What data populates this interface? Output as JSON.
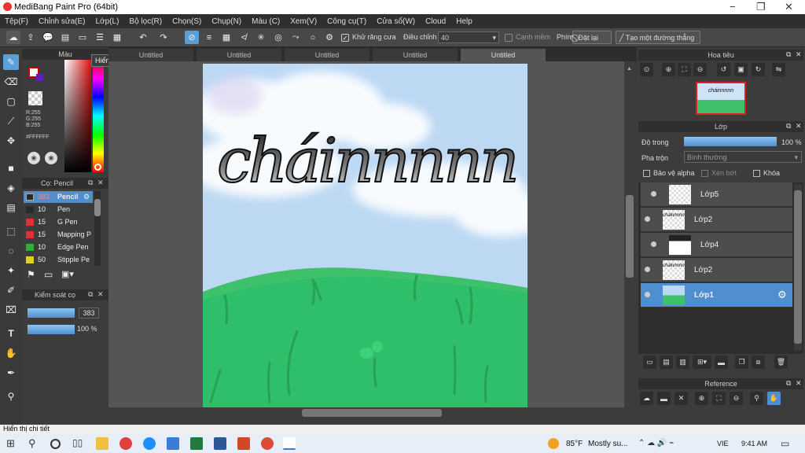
{
  "window": {
    "title": "MediBang Paint Pro (64bit)",
    "minimize": "−",
    "maximize": "❐",
    "close": "✕"
  },
  "menu": [
    "Tệp(F)",
    "Chỉnh sửa(E)",
    "Lớp(L)",
    "Bộ lọc(R)",
    "Chọn(S)",
    "Chụp(N)",
    "Màu (C)",
    "Xem(V)",
    "Công cụ(T)",
    "Cửa sổ(W)",
    "Cloud",
    "Help"
  ],
  "toolbar": {
    "antialias_label": "Khử răng cưa",
    "adjust_label": "Điều chỉnh",
    "adjust_value": "40",
    "edge_label": "Cạnh mềm",
    "key_label": "Phím",
    "reset_label": "Đặt lại",
    "straight_label": "Tạo một đường thẳng"
  },
  "tooltip": "Hiển thị chi tiết",
  "color_panel": {
    "title": "Màu",
    "r": "R:255",
    "g": "G:255",
    "b": "B:255",
    "hex": "#FFFFFF"
  },
  "brush_panel": {
    "title": "Cọ: Pencil",
    "items": [
      {
        "size": "383",
        "name": "Pencil",
        "color": "#4a8ad0"
      },
      {
        "size": "10",
        "name": "Pen",
        "color": "#2a2a2a"
      },
      {
        "size": "15",
        "name": "G Pen",
        "color": "#e03030"
      },
      {
        "size": "15",
        "name": "Mapping P",
        "color": "#e03030"
      },
      {
        "size": "10",
        "name": "Edge Pen",
        "color": "#30b030"
      },
      {
        "size": "50",
        "name": "Stipple Pe",
        "color": "#e0d020"
      }
    ]
  },
  "control_panel": {
    "title": "Kiểm soát cọ",
    "size": "383",
    "opacity": "100 %",
    "size_fill": 1.0,
    "opacity_fill": 1.0
  },
  "tabs": [
    "Untitled",
    "Untitled",
    "Untitled",
    "Untitled",
    "Untitled"
  ],
  "canvas": {
    "text": "cháinnnnn"
  },
  "navigator": {
    "title": "Hoa tiêu"
  },
  "layer_panel": {
    "title": "Lớp",
    "opacity_label": "Độ trong",
    "opacity_value": "100 %",
    "opacity_fill": 1.0,
    "blend_label": "Pha trộn",
    "blend_value": "Bình thường",
    "protect_alpha": "Bảo vệ alpha",
    "clip": "Xén bớt",
    "lock": "Khóa",
    "layers": [
      {
        "name": "Lớp5"
      },
      {
        "name": "Lớp2"
      },
      {
        "name": "Lớp4"
      },
      {
        "name": "Lớp2"
      },
      {
        "name": "Lớp1"
      }
    ]
  },
  "reference": {
    "title": "Reference"
  },
  "status": {
    "text": "Hiển thị chi tiết"
  },
  "taskbar": {
    "weather_temp": "85°F",
    "weather_text": "Mostly su...",
    "lang": "VIE",
    "time": "9:41 AM"
  }
}
